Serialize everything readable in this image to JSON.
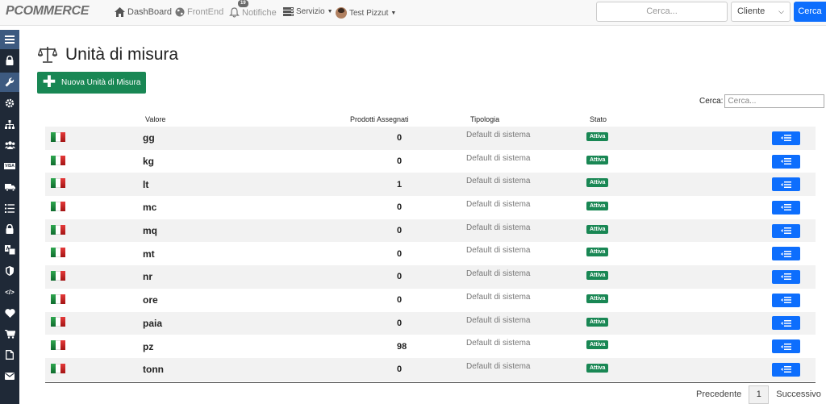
{
  "navbar": {
    "brand": "PCOMMERCE",
    "dashboard": "DashBoard",
    "frontend": "FrontEnd",
    "notifiche": "Notifiche",
    "notifiche_count": "19",
    "servizio": "Servizio",
    "user": "Test Pizzut",
    "search_placeholder": "Cerca...",
    "search_scope": "Cliente",
    "search_button": "Cerca"
  },
  "sidebar": {
    "icons": [
      "menu-icon",
      "lock-icon",
      "wrench-icon",
      "gear-icon",
      "sitemap-icon",
      "users-icon",
      "visa-card-icon",
      "truck-icon",
      "list-icon",
      "lock-icon",
      "translate-icon",
      "shield-icon",
      "code-icon",
      "heart-icon",
      "cart-icon",
      "file-icon",
      "mail-icon"
    ],
    "visa_label": "VISA",
    "code_label": "</>"
  },
  "page": {
    "title": "Unità di misura",
    "new_button": "Nuova Unità di Misura",
    "filter_label": "Cerca:",
    "filter_placeholder": "Cerca..."
  },
  "table": {
    "headers": {
      "valore": "Valore",
      "prodotti": "Prodotti Assegnati",
      "tipologia": "Tipologia",
      "stato": "Stato"
    },
    "rows": [
      {
        "valore": "gg",
        "prodotti": "0",
        "tipologia": "Default di sistema",
        "stato": "Attiva"
      },
      {
        "valore": "kg",
        "prodotti": "0",
        "tipologia": "Default di sistema",
        "stato": "Attiva"
      },
      {
        "valore": "lt",
        "prodotti": "1",
        "tipologia": "Default di sistema",
        "stato": "Attiva"
      },
      {
        "valore": "mc",
        "prodotti": "0",
        "tipologia": "Default di sistema",
        "stato": "Attiva"
      },
      {
        "valore": "mq",
        "prodotti": "0",
        "tipologia": "Default di sistema",
        "stato": "Attiva"
      },
      {
        "valore": "mt",
        "prodotti": "0",
        "tipologia": "Default di sistema",
        "stato": "Attiva"
      },
      {
        "valore": "nr",
        "prodotti": "0",
        "tipologia": "Default di sistema",
        "stato": "Attiva"
      },
      {
        "valore": "ore",
        "prodotti": "0",
        "tipologia": "Default di sistema",
        "stato": "Attiva"
      },
      {
        "valore": "paia",
        "prodotti": "0",
        "tipologia": "Default di sistema",
        "stato": "Attiva"
      },
      {
        "valore": "pz",
        "prodotti": "98",
        "tipologia": "Default di sistema",
        "stato": "Attiva"
      },
      {
        "valore": "tonn",
        "prodotti": "0",
        "tipologia": "Default di sistema",
        "stato": "Attiva"
      }
    ]
  },
  "pagination": {
    "prev": "Precedente",
    "page": "1",
    "next": "Successivo"
  },
  "colors": {
    "primary": "#0d6efd",
    "success": "#198754",
    "sidebar": "#1f2937"
  }
}
